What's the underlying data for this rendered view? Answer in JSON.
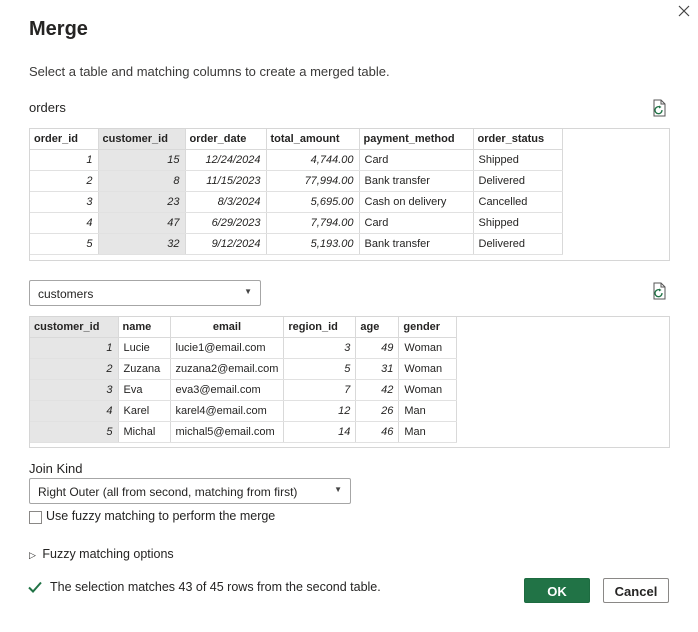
{
  "dialog": {
    "title": "Merge",
    "subtitle": "Select a table and matching columns to create a merged table."
  },
  "first_table": {
    "name": "orders",
    "columns": [
      "order_id",
      "customer_id",
      "order_date",
      "total_amount",
      "payment_method",
      "order_status"
    ],
    "rows": [
      [
        "1",
        "15",
        "12/24/2024",
        "4,744.00",
        "Card",
        "Shipped"
      ],
      [
        "2",
        "8",
        "11/15/2023",
        "77,994.00",
        "Bank transfer",
        "Delivered"
      ],
      [
        "3",
        "23",
        "8/3/2024",
        "5,695.00",
        "Cash on delivery",
        "Cancelled"
      ],
      [
        "4",
        "47",
        "6/29/2023",
        "7,794.00",
        "Card",
        "Shipped"
      ],
      [
        "5",
        "32",
        "9/12/2024",
        "5,193.00",
        "Bank transfer",
        "Delivered"
      ]
    ],
    "selected_column": "customer_id"
  },
  "second_table": {
    "selected": "customers",
    "columns": [
      "customer_id",
      "name",
      "email",
      "region_id",
      "age",
      "gender"
    ],
    "rows": [
      [
        "1",
        "Lucie",
        "lucie1@email.com",
        "3",
        "49",
        "Woman"
      ],
      [
        "2",
        "Zuzana",
        "zuzana2@email.com",
        "5",
        "31",
        "Woman"
      ],
      [
        "3",
        "Eva",
        "eva3@email.com",
        "7",
        "42",
        "Woman"
      ],
      [
        "4",
        "Karel",
        "karel4@email.com",
        "12",
        "26",
        "Man"
      ],
      [
        "5",
        "Michal",
        "michal5@email.com",
        "14",
        "46",
        "Man"
      ]
    ],
    "selected_column": "customer_id"
  },
  "join": {
    "label": "Join Kind",
    "value": "Right Outer (all from second, matching from first)",
    "fuzzy_label": "Use fuzzy matching to perform the merge",
    "fuzzy_options_label": "Fuzzy matching options"
  },
  "status": {
    "text": "The selection matches 43 of 45 rows from the second table."
  },
  "buttons": {
    "ok": "OK",
    "cancel": "Cancel"
  },
  "colors": {
    "accent": "#217346",
    "selected_column_bg": "#e6e6e6"
  }
}
